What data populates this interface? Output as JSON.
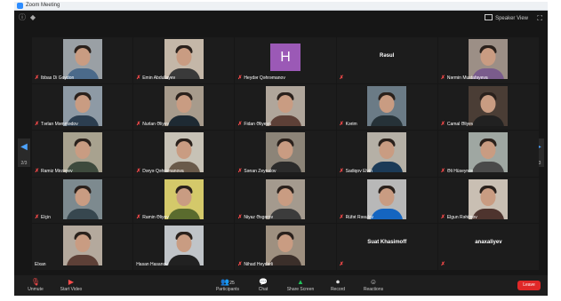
{
  "window": {
    "title": "Zoom Meeting"
  },
  "top_bar": {
    "speaker_view_label": "Speaker View",
    "info_icon": "info-icon",
    "shield_icon": "shield-icon",
    "fullscreen_icon": "fullscreen-icon"
  },
  "pagination": {
    "left": "2/3",
    "right": "2/3"
  },
  "participants": [
    {
      "label": "Ibbas Di Goydon",
      "type": "video",
      "muted": true,
      "shirt": "#4b6a8a",
      "bg": "#9aa0a5"
    },
    {
      "label": "Emin Abdullayev",
      "type": "video",
      "muted": true,
      "shirt": "#3a3a3a",
      "bg": "#c4b7a8"
    },
    {
      "label": "Heydər Qəhrəmanov",
      "type": "avatar",
      "initial": "H",
      "muted": true
    },
    {
      "label": "",
      "center_name": "Rəsul",
      "type": "name",
      "muted": true
    },
    {
      "label": "Nərmin Mustafayeva",
      "type": "video",
      "muted": true,
      "shirt": "#7a5c8c",
      "bg": "#9c8f86"
    },
    {
      "label": "Tərlan Məmmədov",
      "type": "video",
      "muted": true,
      "shirt": "#2c3e50",
      "bg": "#8e9aa5"
    },
    {
      "label": "Nurlan Əliyev",
      "type": "video",
      "muted": true,
      "shirt": "#1e2a33",
      "bg": "#a79b8c"
    },
    {
      "label": "Fidan Əliyeva",
      "type": "video",
      "muted": true,
      "shirt": "#5d4037",
      "bg": "#b0a69b"
    },
    {
      "label": "Kərim",
      "type": "video",
      "muted": true,
      "shirt": "#263238",
      "bg": "#6b7b86"
    },
    {
      "label": "Camal Əliyev",
      "type": "video",
      "muted": true,
      "shirt": "#212121",
      "bg": "#4a3d35"
    },
    {
      "label": "Ramiz Mirzəyev",
      "type": "video",
      "muted": true,
      "shirt": "#3e4a3d",
      "bg": "#a8a28f"
    },
    {
      "label": "Dəryə Qəhrəmanova",
      "type": "video",
      "muted": true,
      "shirt": "#6a5a4a",
      "bg": "#c7c2b6"
    },
    {
      "label": "Sənan Zeynalov",
      "type": "video",
      "muted": true,
      "shirt": "#2b2b2b",
      "bg": "#8c8478"
    },
    {
      "label": "Sadiqov Elvin",
      "type": "video",
      "muted": true,
      "shirt": "#1b3a57",
      "bg": "#b5b0a6"
    },
    {
      "label": "Əli Hüseynov",
      "type": "video",
      "muted": true,
      "shirt": "#4a4a4a",
      "bg": "#9fa7a2"
    },
    {
      "label": "Elçin",
      "type": "video",
      "muted": true,
      "shirt": "#37474f",
      "bg": "#7d8a8f"
    },
    {
      "label": "Ramin Əliyev",
      "type": "video",
      "muted": true,
      "shirt": "#5a6b2e",
      "bg": "#d4c96a"
    },
    {
      "label": "Niyaz Əsgərov",
      "type": "video",
      "muted": true,
      "shirt": "#3c3c3c",
      "bg": "#a49a8e"
    },
    {
      "label": "Rüfət Rəsulov",
      "type": "video",
      "muted": true,
      "shirt": "#1565c0",
      "bg": "#b8b8b8"
    },
    {
      "label": "Elgun Rəhimov",
      "type": "video",
      "muted": true,
      "shirt": "#4e342e",
      "bg": "#c9bfb3"
    },
    {
      "label": "Elxan",
      "type": "video",
      "muted": false,
      "shirt": "#5d4037",
      "bg": "#b4a99d"
    },
    {
      "label": "Hasan Hasanov",
      "type": "video",
      "muted": false,
      "shirt": "#212121",
      "bg": "#c0c4c8"
    },
    {
      "label": "Nihad Heydərli",
      "type": "video",
      "muted": true,
      "shirt": "#3b2f2a",
      "bg": "#9e9080"
    },
    {
      "label": "",
      "center_name": "Suat Khasimoff",
      "type": "name",
      "muted": true
    },
    {
      "label": "",
      "center_name": "anaxaliyev",
      "type": "name",
      "muted": true
    }
  ],
  "toolbar": {
    "unmute_label": "Unmute",
    "start_video_label": "Start Video",
    "participants_label": "Participants",
    "participants_count": "25",
    "chat_label": "Chat",
    "share_screen_label": "Share Screen",
    "record_label": "Record",
    "reactions_label": "Reactions",
    "end_label": "Leave"
  },
  "colors": {
    "background": "#161616",
    "share": "#22c25a",
    "end": "#e02828",
    "mute": "#ff4b4b",
    "avatar": "#9b59b6"
  }
}
